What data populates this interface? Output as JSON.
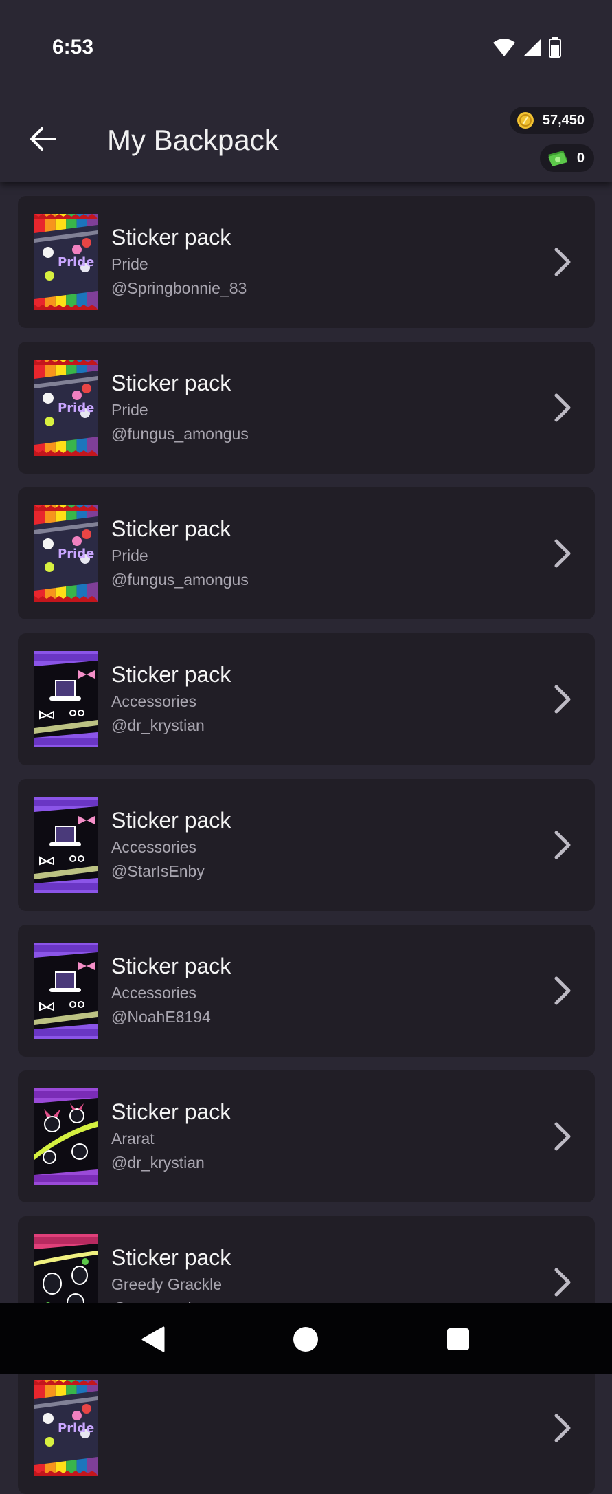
{
  "status_bar": {
    "time": "6:53"
  },
  "header": {
    "title": "My Backpack",
    "coins": "57,450",
    "cash": "0"
  },
  "items": [
    {
      "title": "Sticker pack",
      "subtitle": "Pride",
      "user": "@Springbonnie_83",
      "art": "pride"
    },
    {
      "title": "Sticker pack",
      "subtitle": "Pride",
      "user": "@fungus_amongus",
      "art": "pride"
    },
    {
      "title": "Sticker pack",
      "subtitle": "Pride",
      "user": "@fungus_amongus",
      "art": "pride"
    },
    {
      "title": "Sticker pack",
      "subtitle": "Accessories",
      "user": "@dr_krystian",
      "art": "accessories"
    },
    {
      "title": "Sticker pack",
      "subtitle": "Accessories",
      "user": "@StarIsEnby",
      "art": "accessories"
    },
    {
      "title": "Sticker pack",
      "subtitle": "Accessories",
      "user": "@NoahE8194",
      "art": "accessories"
    },
    {
      "title": "Sticker pack",
      "subtitle": "Ararat",
      "user": "@dr_krystian",
      "art": "ararat"
    },
    {
      "title": "Sticker pack",
      "subtitle": "Greedy Grackle",
      "user": "@StarIsEnby",
      "art": "grackle"
    },
    {
      "title": "",
      "subtitle": "",
      "user": "",
      "art": "pride"
    }
  ],
  "colors": {
    "background": "#2a2733",
    "card": "#211e26",
    "text_secondary": "#a9a6b0",
    "coin": "#f2c232",
    "cash": "#5cc84a"
  },
  "icons": {
    "back": "arrow-left-icon",
    "chevron": "chevron-right-icon",
    "coin": "coin-icon",
    "cash": "cash-icon",
    "wifi": "wifi-icon",
    "signal": "signal-icon",
    "battery": "battery-icon"
  }
}
